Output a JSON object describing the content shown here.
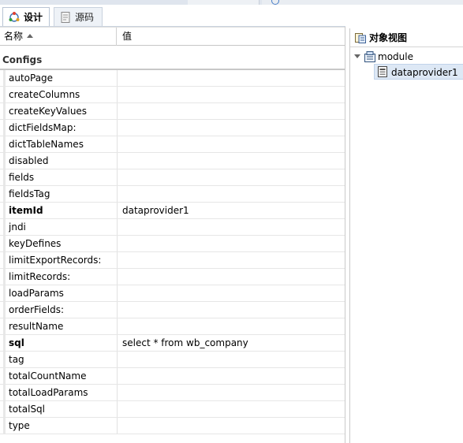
{
  "tabs": [
    {
      "label": "设计",
      "icon": "design-icon",
      "active": true
    },
    {
      "label": "源码",
      "icon": "source-icon",
      "active": false
    }
  ],
  "header": {
    "name_col": "名称",
    "value_col": "值"
  },
  "group": {
    "label": "Configs"
  },
  "properties": [
    {
      "name": "autoPage",
      "value": "",
      "bold": false
    },
    {
      "name": "createColumns",
      "value": "",
      "bold": false
    },
    {
      "name": "createKeyValues",
      "value": "",
      "bold": false
    },
    {
      "name": "dictFieldsMap:",
      "value": "",
      "bold": false
    },
    {
      "name": "dictTableNames",
      "value": "",
      "bold": false
    },
    {
      "name": "disabled",
      "value": "",
      "bold": false
    },
    {
      "name": "fields",
      "value": "",
      "bold": false
    },
    {
      "name": "fieldsTag",
      "value": "",
      "bold": false
    },
    {
      "name": "itemId",
      "value": "dataprovider1",
      "bold": true
    },
    {
      "name": "jndi",
      "value": "",
      "bold": false
    },
    {
      "name": "keyDefines",
      "value": "",
      "bold": false
    },
    {
      "name": "limitExportRecords:",
      "value": "",
      "bold": false
    },
    {
      "name": "limitRecords:",
      "value": "",
      "bold": false
    },
    {
      "name": "loadParams",
      "value": "",
      "bold": false
    },
    {
      "name": "orderFields:",
      "value": "",
      "bold": false
    },
    {
      "name": "resultName",
      "value": "",
      "bold": false
    },
    {
      "name": "sql",
      "value": "select * from wb_company",
      "bold": true
    },
    {
      "name": "tag",
      "value": "",
      "bold": false
    },
    {
      "name": "totalCountName",
      "value": "",
      "bold": false
    },
    {
      "name": "totalLoadParams",
      "value": "",
      "bold": false
    },
    {
      "name": "totalSql",
      "value": "",
      "bold": false
    },
    {
      "name": "type",
      "value": "",
      "bold": false
    }
  ],
  "object_view": {
    "title": "对象视图",
    "tree": [
      {
        "label": "module",
        "icon": "module-icon",
        "expanded": true
      },
      {
        "label": "dataprovider1",
        "icon": "dataprovider-icon",
        "selected": true
      }
    ]
  }
}
